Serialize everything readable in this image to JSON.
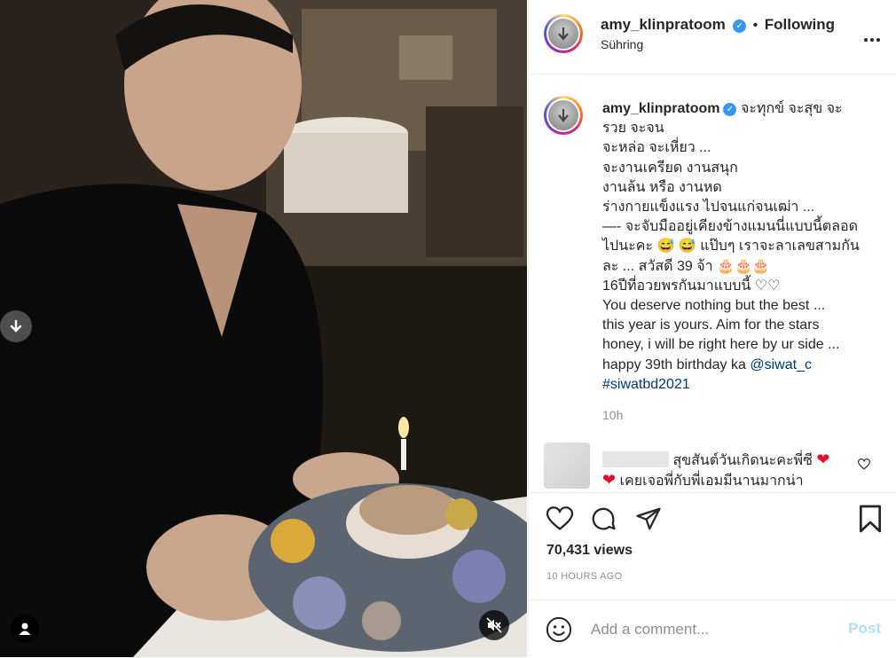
{
  "colors": {
    "accent": "#3897f0",
    "link": "#00376b",
    "muted": "#8e8e8e",
    "heart": "#e0102b",
    "post_disabled": "#b2dffc"
  },
  "header": {
    "username": "amy_klinpratoom",
    "separator": "•",
    "follow_status": "Following",
    "subtitle": "Sühring",
    "more_icon": "more-horizontal-icon"
  },
  "caption": {
    "username": "amy_klinpratoom",
    "lines": [
      "จะทุกข์ จะสุข จะ",
      "รวย จะจน",
      "จะหล่อ จะเหี่ยว ...",
      "จะงานเครียด งานสนุก",
      "งานล้น หรือ งานหด",
      "ร่างกายแข็งแรง ไปจนแก่จนเฒ่า ...",
      "—- จะจับมืออยู่เคียงข้างแมนนี่แบบนี้ตลอด",
      "ไปนะคะ 😅 😅 แป๊บๆ เราจะลาเลขสามกัน",
      "ละ ... สวัสดี 39 จ้า 🎂🎂🎂",
      "16ปีที่อวยพรกันมาแบบนี้ ♡♡",
      "You deserve nothing but the best ...",
      "this year is yours. Aim for the stars",
      "honey, i will be right here by ur side ...",
      "happy 39th birthday ka "
    ],
    "mention": "@siwat_c",
    "hashtag": "#siwatbd2021",
    "time": "10h"
  },
  "comment": {
    "line1": "สุขสันต์วันเกิดนะคะพี่ซี",
    "line2": "เคยเจอพี่กับพี่เอมมีนานมากน่า"
  },
  "actions": {
    "like_icon": "heart-icon",
    "comment_icon": "comment-icon",
    "share_icon": "share-icon",
    "save_icon": "bookmark-icon"
  },
  "views": "70,431 views",
  "posted_ago": "10 HOURS AGO",
  "comment_box": {
    "emoji_icon": "emoji-icon",
    "placeholder": "Add a comment...",
    "post_label": "Post"
  }
}
